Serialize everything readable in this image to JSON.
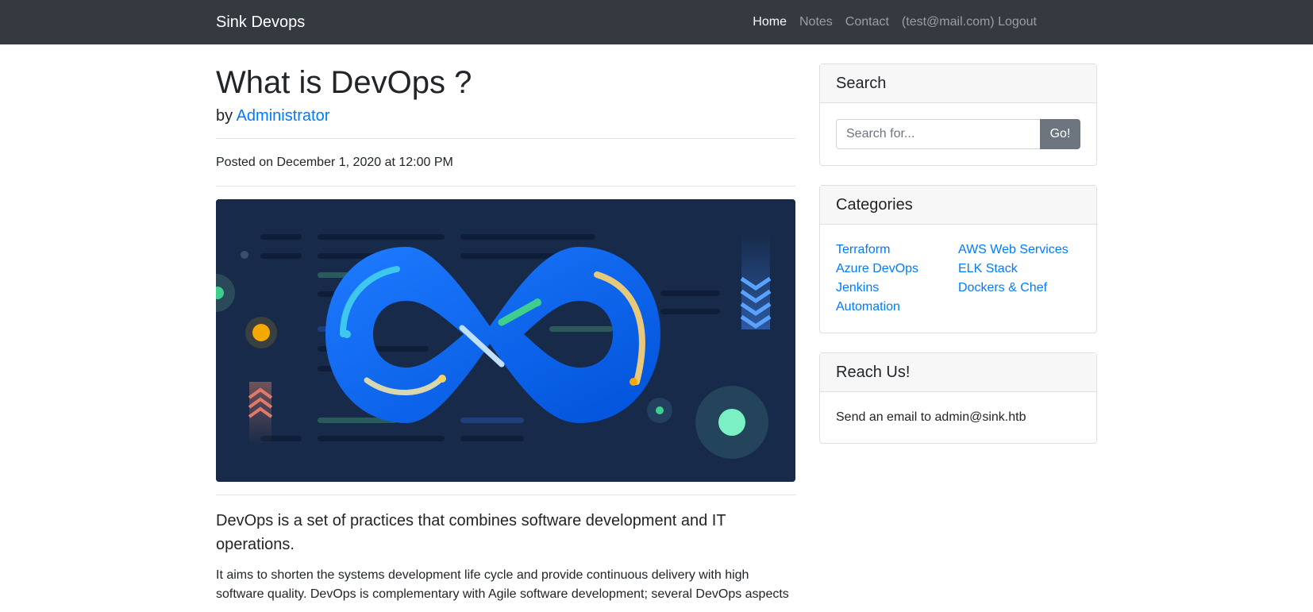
{
  "navbar": {
    "brand": "Sink Devops",
    "links": {
      "home": "Home",
      "notes": "Notes",
      "contact": "Contact",
      "logout": "(test@mail.com) Logout"
    }
  },
  "post": {
    "title": "What is DevOps ?",
    "by_prefix": "by",
    "author": "Administrator",
    "posted": "Posted on December 1, 2020 at 12:00 PM",
    "lead": "DevOps is a set of practices that combines software development and IT operations.",
    "body": "It aims to shorten the systems development life cycle and provide continuous delivery with high software quality. DevOps is complementary with Agile software development; several DevOps aspects"
  },
  "sidebar": {
    "search": {
      "title": "Search",
      "placeholder": "Search for...",
      "button": "Go!"
    },
    "categories": {
      "title": "Categories",
      "left": [
        "Terraform",
        "Azure DevOps",
        "Jenkins",
        "Automation"
      ],
      "right": [
        "AWS Web Services",
        "ELK Stack",
        "Dockers & Chef"
      ]
    },
    "reach": {
      "title": "Reach Us!",
      "text": "Send an email to admin@sink.htb"
    }
  },
  "colors": {
    "navbar": "#343a40",
    "link": "#007bff",
    "button": "#6c757d",
    "hero_bg": "#172a4a",
    "infinity": "#0a6cff"
  }
}
